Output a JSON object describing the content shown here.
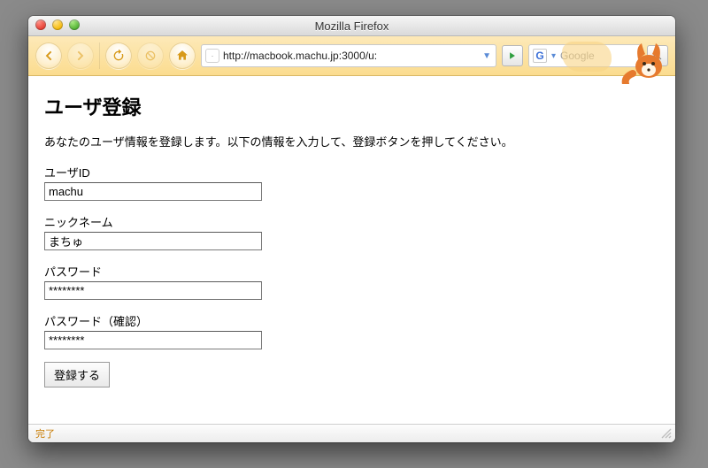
{
  "window": {
    "title": "Mozilla Firefox"
  },
  "toolbar": {
    "url": "http://macbook.machu.jp:3000/u:",
    "search_engine_icon": "G",
    "search_placeholder": "Google"
  },
  "page": {
    "heading": "ユーザ登録",
    "intro": "あなたのユーザ情報を登録します。以下の情報を入力して、登録ボタンを押してください。",
    "fields": {
      "user_id": {
        "label": "ユーザID",
        "value": "machu",
        "type": "text"
      },
      "nickname": {
        "label": "ニックネーム",
        "value": "まちゅ",
        "type": "text"
      },
      "password": {
        "label": "パスワード",
        "value": "********",
        "type": "password"
      },
      "password2": {
        "label": "パスワード（確認）",
        "value": "********",
        "type": "password"
      }
    },
    "submit_label": "登録する"
  },
  "status": {
    "text": "完了"
  }
}
